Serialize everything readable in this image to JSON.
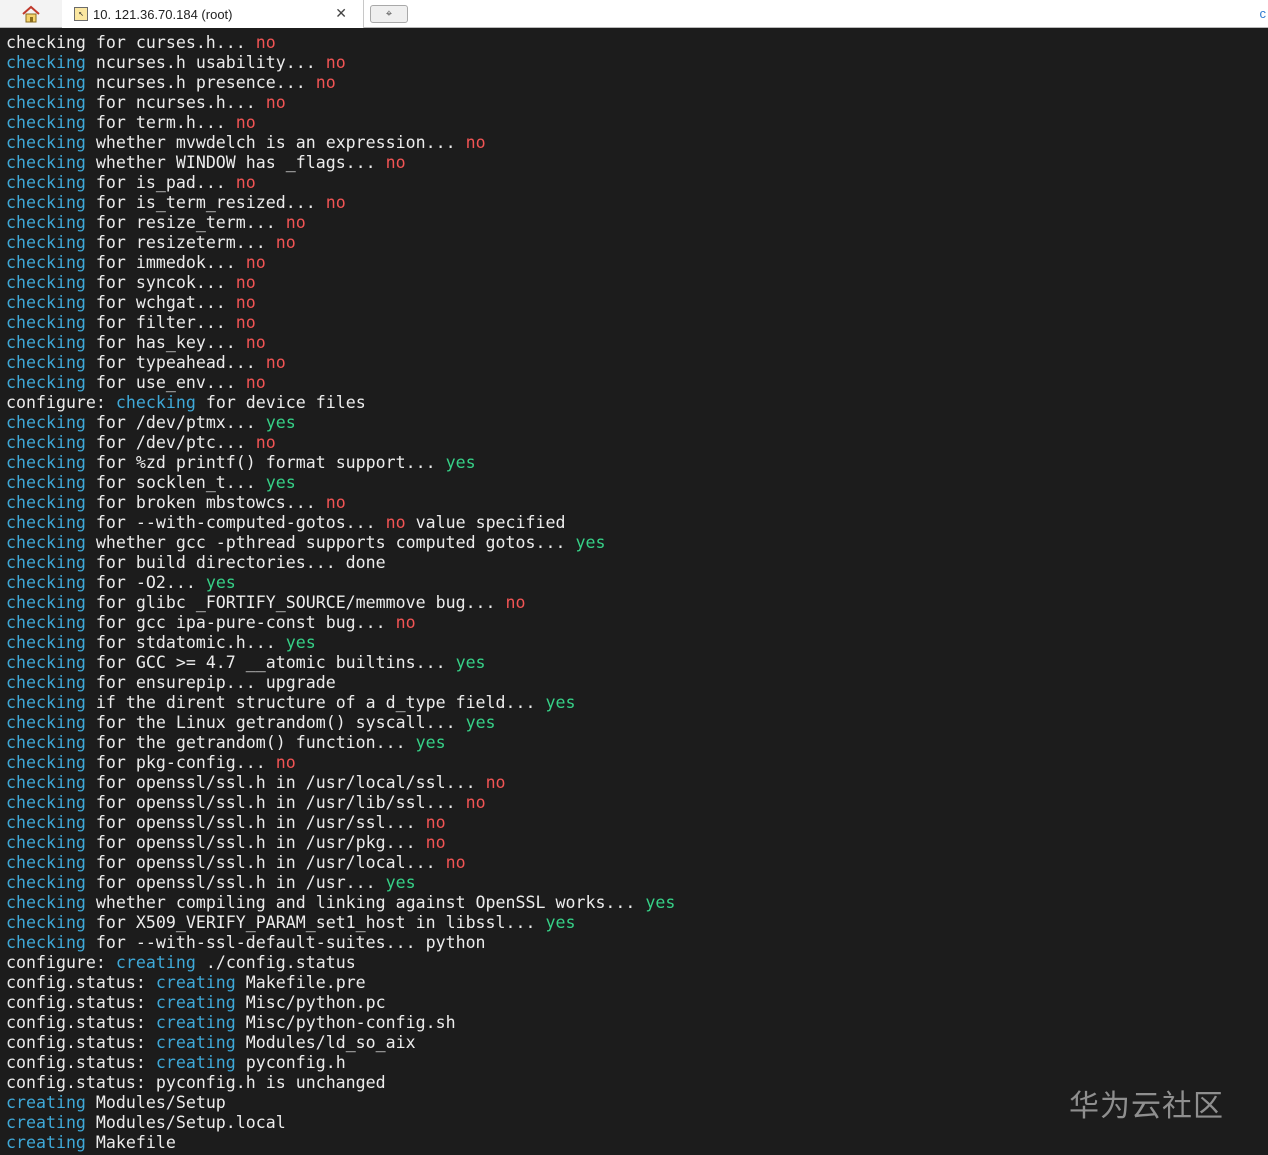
{
  "tabs": {
    "home_icon": "home-icon",
    "session_icon": "putty-session-icon",
    "session_title": "10. 121.36.70.184 (root)",
    "close_glyph": "✕",
    "new_tab_icon": "new-tab-icon",
    "new_tab_glyph": "⌖",
    "edge_glyph": "c"
  },
  "colors": {
    "terminal_bg": "#1c1c1c",
    "text": "#ececec",
    "keyword": "#3fa9d8",
    "no": "#f05454",
    "yes": "#36d087"
  },
  "terminal": {
    "lines": [
      [
        [
          "n",
          "checking for curses.h... "
        ],
        [
          "r",
          "no"
        ]
      ],
      [
        [
          "b",
          "checking"
        ],
        [
          "n",
          " ncurses.h usability... "
        ],
        [
          "r",
          "no"
        ]
      ],
      [
        [
          "b",
          "checking"
        ],
        [
          "n",
          " ncurses.h presence... "
        ],
        [
          "r",
          "no"
        ]
      ],
      [
        [
          "b",
          "checking"
        ],
        [
          "n",
          " for ncurses.h... "
        ],
        [
          "r",
          "no"
        ]
      ],
      [
        [
          "b",
          "checking"
        ],
        [
          "n",
          " for term.h... "
        ],
        [
          "r",
          "no"
        ]
      ],
      [
        [
          "b",
          "checking"
        ],
        [
          "n",
          " whether mvwdelch is an expression... "
        ],
        [
          "r",
          "no"
        ]
      ],
      [
        [
          "b",
          "checking"
        ],
        [
          "n",
          " whether WINDOW has _flags... "
        ],
        [
          "r",
          "no"
        ]
      ],
      [
        [
          "b",
          "checking"
        ],
        [
          "n",
          " for is_pad... "
        ],
        [
          "r",
          "no"
        ]
      ],
      [
        [
          "b",
          "checking"
        ],
        [
          "n",
          " for is_term_resized... "
        ],
        [
          "r",
          "no"
        ]
      ],
      [
        [
          "b",
          "checking"
        ],
        [
          "n",
          " for resize_term... "
        ],
        [
          "r",
          "no"
        ]
      ],
      [
        [
          "b",
          "checking"
        ],
        [
          "n",
          " for resizeterm... "
        ],
        [
          "r",
          "no"
        ]
      ],
      [
        [
          "b",
          "checking"
        ],
        [
          "n",
          " for immedok... "
        ],
        [
          "r",
          "no"
        ]
      ],
      [
        [
          "b",
          "checking"
        ],
        [
          "n",
          " for syncok... "
        ],
        [
          "r",
          "no"
        ]
      ],
      [
        [
          "b",
          "checking"
        ],
        [
          "n",
          " for wchgat... "
        ],
        [
          "r",
          "no"
        ]
      ],
      [
        [
          "b",
          "checking"
        ],
        [
          "n",
          " for filter... "
        ],
        [
          "r",
          "no"
        ]
      ],
      [
        [
          "b",
          "checking"
        ],
        [
          "n",
          " for has_key... "
        ],
        [
          "r",
          "no"
        ]
      ],
      [
        [
          "b",
          "checking"
        ],
        [
          "n",
          " for typeahead... "
        ],
        [
          "r",
          "no"
        ]
      ],
      [
        [
          "b",
          "checking"
        ],
        [
          "n",
          " for use_env... "
        ],
        [
          "r",
          "no"
        ]
      ],
      [
        [
          "n",
          "configure: "
        ],
        [
          "b",
          "checking"
        ],
        [
          "n",
          " for device files"
        ]
      ],
      [
        [
          "b",
          "checking"
        ],
        [
          "n",
          " for /dev/ptmx... "
        ],
        [
          "g",
          "yes"
        ]
      ],
      [
        [
          "b",
          "checking"
        ],
        [
          "n",
          " for /dev/ptc... "
        ],
        [
          "r",
          "no"
        ]
      ],
      [
        [
          "b",
          "checking"
        ],
        [
          "n",
          " for %zd printf() format support... "
        ],
        [
          "g",
          "yes"
        ]
      ],
      [
        [
          "b",
          "checking"
        ],
        [
          "n",
          " for socklen_t... "
        ],
        [
          "g",
          "yes"
        ]
      ],
      [
        [
          "b",
          "checking"
        ],
        [
          "n",
          " for broken mbstowcs... "
        ],
        [
          "r",
          "no"
        ]
      ],
      [
        [
          "b",
          "checking"
        ],
        [
          "n",
          " for --with-computed-gotos... "
        ],
        [
          "r",
          "no"
        ],
        [
          "n",
          " value specified"
        ]
      ],
      [
        [
          "b",
          "checking"
        ],
        [
          "n",
          " whether gcc -pthread supports computed gotos... "
        ],
        [
          "g",
          "yes"
        ]
      ],
      [
        [
          "b",
          "checking"
        ],
        [
          "n",
          " for build directories... done"
        ]
      ],
      [
        [
          "b",
          "checking"
        ],
        [
          "n",
          " for -O2... "
        ],
        [
          "g",
          "yes"
        ]
      ],
      [
        [
          "b",
          "checking"
        ],
        [
          "n",
          " for glibc _FORTIFY_SOURCE/memmove bug... "
        ],
        [
          "r",
          "no"
        ]
      ],
      [
        [
          "b",
          "checking"
        ],
        [
          "n",
          " for gcc ipa-pure-const bug... "
        ],
        [
          "r",
          "no"
        ]
      ],
      [
        [
          "b",
          "checking"
        ],
        [
          "n",
          " for stdatomic.h... "
        ],
        [
          "g",
          "yes"
        ]
      ],
      [
        [
          "b",
          "checking"
        ],
        [
          "n",
          " for GCC >= 4.7 __atomic builtins... "
        ],
        [
          "g",
          "yes"
        ]
      ],
      [
        [
          "b",
          "checking"
        ],
        [
          "n",
          " for ensurepip... upgrade"
        ]
      ],
      [
        [
          "b",
          "checking"
        ],
        [
          "n",
          " if the dirent structure of a d_type field... "
        ],
        [
          "g",
          "yes"
        ]
      ],
      [
        [
          "b",
          "checking"
        ],
        [
          "n",
          " for the Linux getrandom() syscall... "
        ],
        [
          "g",
          "yes"
        ]
      ],
      [
        [
          "b",
          "checking"
        ],
        [
          "n",
          " for the getrandom() function... "
        ],
        [
          "g",
          "yes"
        ]
      ],
      [
        [
          "b",
          "checking"
        ],
        [
          "n",
          " for pkg-config... "
        ],
        [
          "r",
          "no"
        ]
      ],
      [
        [
          "b",
          "checking"
        ],
        [
          "n",
          " for openssl/ssl.h in /usr/local/ssl... "
        ],
        [
          "r",
          "no"
        ]
      ],
      [
        [
          "b",
          "checking"
        ],
        [
          "n",
          " for openssl/ssl.h in /usr/lib/ssl... "
        ],
        [
          "r",
          "no"
        ]
      ],
      [
        [
          "b",
          "checking"
        ],
        [
          "n",
          " for openssl/ssl.h in /usr/ssl... "
        ],
        [
          "r",
          "no"
        ]
      ],
      [
        [
          "b",
          "checking"
        ],
        [
          "n",
          " for openssl/ssl.h in /usr/pkg... "
        ],
        [
          "r",
          "no"
        ]
      ],
      [
        [
          "b",
          "checking"
        ],
        [
          "n",
          " for openssl/ssl.h in /usr/local... "
        ],
        [
          "r",
          "no"
        ]
      ],
      [
        [
          "b",
          "checking"
        ],
        [
          "n",
          " for openssl/ssl.h in /usr... "
        ],
        [
          "g",
          "yes"
        ]
      ],
      [
        [
          "b",
          "checking"
        ],
        [
          "n",
          " whether compiling and linking against OpenSSL works... "
        ],
        [
          "g",
          "yes"
        ]
      ],
      [
        [
          "b",
          "checking"
        ],
        [
          "n",
          " for X509_VERIFY_PARAM_set1_host in libssl... "
        ],
        [
          "g",
          "yes"
        ]
      ],
      [
        [
          "b",
          "checking"
        ],
        [
          "n",
          " for --with-ssl-default-suites... python"
        ]
      ],
      [
        [
          "n",
          "configure: "
        ],
        [
          "b",
          "creating"
        ],
        [
          "n",
          " ./config.status"
        ]
      ],
      [
        [
          "n",
          "config.status: "
        ],
        [
          "b",
          "creating"
        ],
        [
          "n",
          " Makefile.pre"
        ]
      ],
      [
        [
          "n",
          "config.status: "
        ],
        [
          "b",
          "creating"
        ],
        [
          "n",
          " Misc/python.pc"
        ]
      ],
      [
        [
          "n",
          "config.status: "
        ],
        [
          "b",
          "creating"
        ],
        [
          "n",
          " Misc/python-config.sh"
        ]
      ],
      [
        [
          "n",
          "config.status: "
        ],
        [
          "b",
          "creating"
        ],
        [
          "n",
          " Modules/ld_so_aix"
        ]
      ],
      [
        [
          "n",
          "config.status: "
        ],
        [
          "b",
          "creating"
        ],
        [
          "n",
          " pyconfig.h"
        ]
      ],
      [
        [
          "n",
          "config.status: pyconfig.h is unchanged"
        ]
      ],
      [
        [
          "b",
          "creating"
        ],
        [
          "n",
          " Modules/Setup"
        ]
      ],
      [
        [
          "b",
          "creating"
        ],
        [
          "n",
          " Modules/Setup.local"
        ]
      ],
      [
        [
          "b",
          "creating"
        ],
        [
          "n",
          " Makefile"
        ]
      ]
    ]
  },
  "watermark": {
    "text": "华为云社区"
  }
}
